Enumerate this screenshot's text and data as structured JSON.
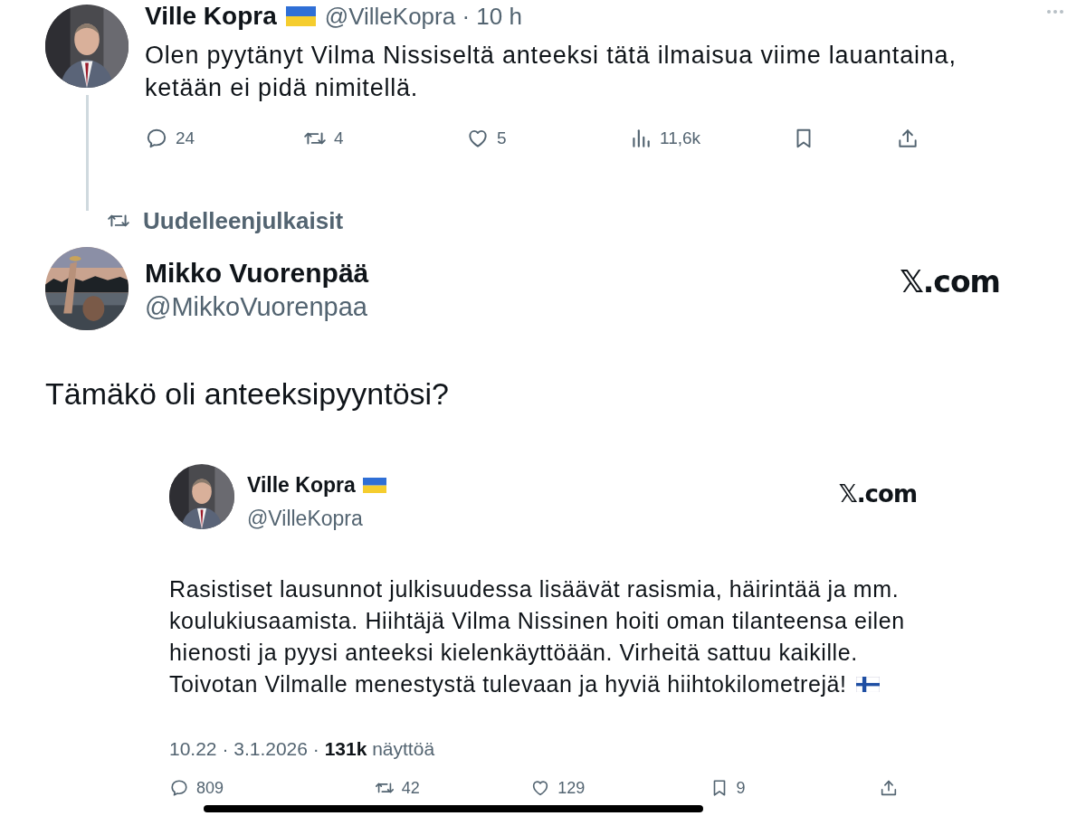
{
  "reply_tweet": {
    "author_name": "Ville Kopra",
    "handle_line": "@VilleKopra · 10 h",
    "text": "Olen pyytänyt Vilma Nissiseltä anteeksi tätä ilmaisua viime lauantaina, ketään ei pidä nimitellä.",
    "actions": [
      {
        "kind": "reply",
        "count": "24"
      },
      {
        "kind": "repost",
        "count": "4"
      },
      {
        "kind": "like",
        "count": "5"
      },
      {
        "kind": "views",
        "count": "11,6k"
      },
      {
        "kind": "bookmark"
      },
      {
        "kind": "share"
      }
    ]
  },
  "repost_label": "Uudelleenjulkaisit",
  "card": {
    "author_name": "Mikko Vuorenpää",
    "handle": "@MikkoVuorenpaa",
    "brand": "𝕏.com",
    "text": "Tämäkö oli anteeksipyyntösi?",
    "quote": {
      "author_name": "Ville Kopra",
      "handle": "@VilleKopra",
      "brand": "𝕏.com",
      "text_blocks": [
        "Rasistiset lausunnot julkisuudessa lisäävät rasismia, häirintää ja mm. koulukiusaamista. Hiihtäjä Vilma Nissinen hoiti oman tilanteensa eilen hienosti ja pyysi anteeksi kielenkäyttöään. Virheitä sattuu kaikille.",
        "Toivotan Vilmalle menestystä tulevaan ja hyviä hiihtokilometrejä!"
      ],
      "meta": "10.22 · 3.1.2026 · **131k** näyttöä",
      "actions": [
        {
          "kind": "reply",
          "count": "809"
        },
        {
          "kind": "repost",
          "count": "42"
        },
        {
          "kind": "like",
          "count": "129"
        },
        {
          "kind": "bookmark",
          "count": "9"
        },
        {
          "kind": "share"
        }
      ]
    }
  }
}
